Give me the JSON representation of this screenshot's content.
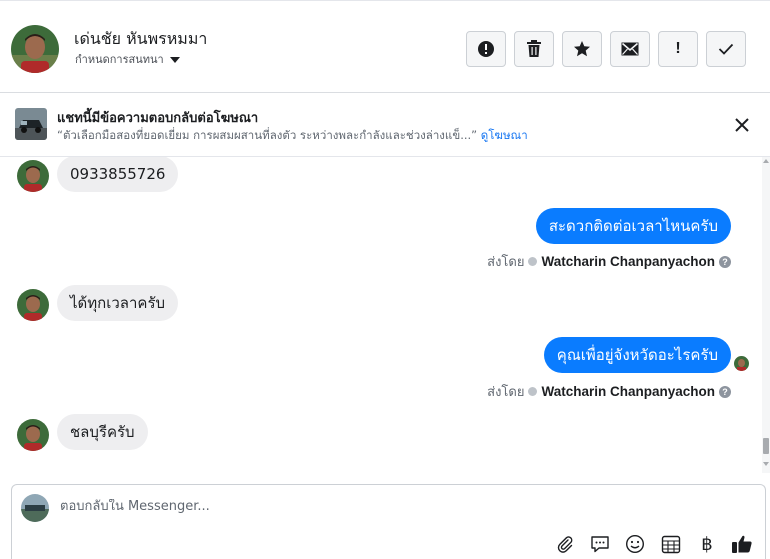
{
  "header": {
    "contact_name": "เด่นชัย หันพรหมมา",
    "conversation_settings": "กำหนดการสนทนา",
    "actions": [
      "report-icon",
      "trash-icon",
      "star-icon",
      "envelope-icon",
      "exclamation-icon",
      "check-icon"
    ],
    "action_exclaim_label": "!"
  },
  "ad_banner": {
    "title": "แชทนี้มีข้อความตอบกลับต่อโฆษณา",
    "quote": "“ตัวเลือกมือสองที่ยอดเยี่ยม การผสมผสานที่ลงตัว ระหว่างพละกำลังและช่วงล่างแข็...”",
    "link_label": "ดูโฆษณา"
  },
  "messages": [
    {
      "direction": "in",
      "text": "0933855726"
    },
    {
      "direction": "out",
      "text": "สะดวกติดต่อเวลาไหนครับ"
    },
    {
      "direction": "meta",
      "prefix": "ส่งโดย",
      "sender": "Watcharin Chanpanyachon"
    },
    {
      "direction": "in",
      "text": "ได้ทุกเวลาครับ"
    },
    {
      "direction": "out",
      "text": "คุณเพื่อยู่จังหวัดอะไรครับ"
    },
    {
      "direction": "meta",
      "prefix": "ส่งโดย",
      "sender": "Watcharin Chanpanyachon"
    },
    {
      "direction": "in",
      "text": "ชลบุรีครับ"
    }
  ],
  "composer": {
    "placeholder": "ตอบกลับใน Messenger...",
    "tools": [
      "paperclip-icon",
      "saved-replies-icon",
      "emoji-icon",
      "appointment-icon",
      "baht-icon",
      "thumbs-up-icon"
    ],
    "baht_symbol": "฿"
  },
  "colors": {
    "accent": "#0a7cff",
    "incoming_bubble": "#eeeef0",
    "link": "#1877f2"
  }
}
